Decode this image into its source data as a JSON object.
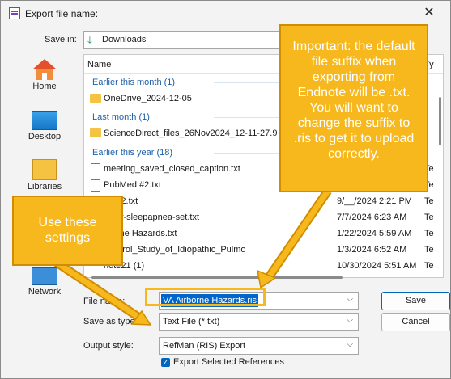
{
  "window": {
    "title": "Export file name:",
    "close_glyph": "✕"
  },
  "save_in": {
    "label": "Save in:",
    "value": "Downloads",
    "icon": "download-icon"
  },
  "places": [
    {
      "label": "Home",
      "icon": "home-icon"
    },
    {
      "label": "Desktop",
      "icon": "desktop-icon"
    },
    {
      "label": "Libraries",
      "icon": "libraries-icon"
    },
    {
      "label": "Network",
      "icon": "network-icon"
    }
  ],
  "list": {
    "col_name": "Name",
    "col_type": "Ty",
    "groups": {
      "earlier_month": "Earlier this month (1)",
      "last_month": "Last month (1)",
      "earlier_year": "Earlier this year (18)"
    },
    "items": [
      {
        "name": "OneDrive_2024-12-05",
        "date": "",
        "type": "",
        "kind": "folder"
      },
      {
        "name": "ScienceDirect_files_26Nov2024_12-11-27.9",
        "date": "",
        "type": "",
        "kind": "folder"
      },
      {
        "name": "meeting_saved_closed_caption.txt",
        "date": "",
        "type": "Te",
        "kind": "doc"
      },
      {
        "name": "PubMed #2.txt",
        "date": "",
        "type": "Te",
        "kind": "doc"
      },
      {
        "name": "Med2.txt",
        "date": "9/__/2024 2:21 PM",
        "type": "Te",
        "kind": "doc"
      },
      {
        "name": "mary-sleepapnea-set.txt",
        "date": "7/7/2024 6:23 AM",
        "type": "Te",
        "kind": "doc"
      },
      {
        "name": "rborne Hazards.txt",
        "date": "1/22/2024 5:59 AM",
        "type": "Te",
        "kind": "doc"
      },
      {
        "name": "Control_Study_of_Idiopathic_Pulmo",
        "date": "1/3/2024 6:52 AM",
        "type": "Te",
        "kind": "doc"
      },
      {
        "name": "note21 (1)",
        "date": "10/30/2024 5:51 AM",
        "type": "Te",
        "kind": "doc"
      }
    ]
  },
  "form": {
    "file_name_label": "File name:",
    "file_name_value": "VA Airborne Hazards.ris",
    "save_as_label": "Save as type:",
    "save_as_value": "Text File (*.txt)",
    "output_style_label": "Output style:",
    "output_style_value": "RefMan (RIS) Export",
    "export_selected_label": "Export Selected References",
    "export_selected_checked": true,
    "save_button": "Save",
    "cancel_button": "Cancel"
  },
  "callouts": {
    "important": "Important: the default file suffix when exporting from Endnote will be .txt. You will want to change the suffix to .ris to get it to upload correctly.",
    "settings": "Use these settings"
  },
  "colors": {
    "callout": "#f6b81c",
    "accent": "#0067c0",
    "group_header": "#1c5fa8"
  }
}
